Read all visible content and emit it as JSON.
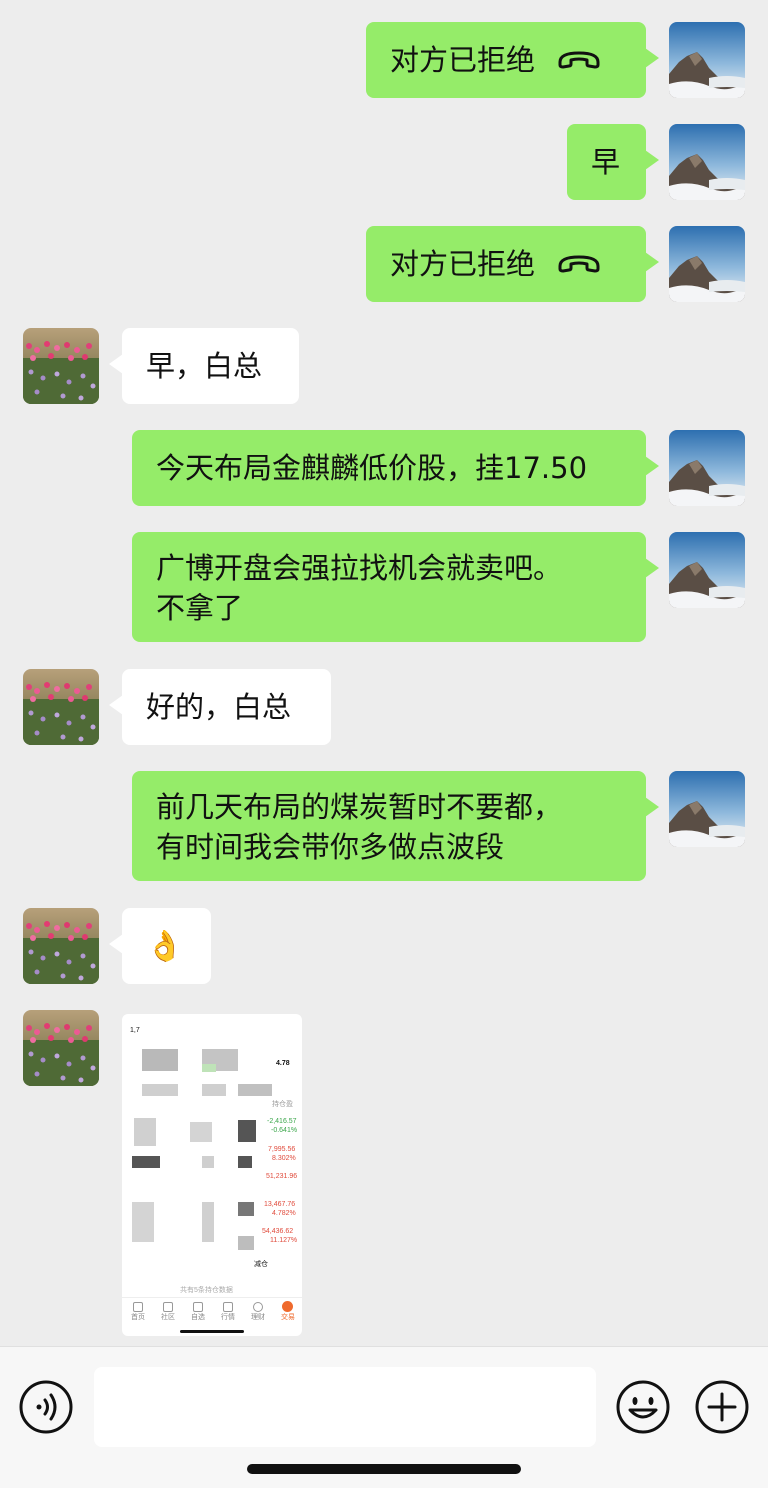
{
  "messages": [
    {
      "id": "m1",
      "side": "me",
      "text": "对方已拒绝",
      "type": "call"
    },
    {
      "id": "m2",
      "side": "me",
      "text": "早"
    },
    {
      "id": "m3",
      "side": "me",
      "text": "对方已拒绝",
      "type": "call"
    },
    {
      "id": "m4",
      "side": "other",
      "text": "早，白总"
    },
    {
      "id": "m5",
      "side": "me",
      "text": "今天布局金麒麟低价股，挂17.50"
    },
    {
      "id": "m6",
      "side": "me",
      "line1": "广博开盘会强拉找机会就卖吧。",
      "line2": "不拿了"
    },
    {
      "id": "m7",
      "side": "other",
      "text": "好的，白总"
    },
    {
      "id": "m8",
      "side": "me",
      "line1": "前几天布局的煤炭暂时不要都，",
      "line2": "有时间我会带你多做点波段"
    },
    {
      "id": "m9",
      "side": "other",
      "text": "👌",
      "icon": "ok-hand-emoji"
    },
    {
      "id": "m10",
      "side": "other",
      "type": "image"
    }
  ],
  "screenshot": {
    "top_label": "1,7",
    "value_a": "4.78",
    "label_b": "持仓盈",
    "rows": [
      {
        "v1": "-2,416.57",
        "v2": "-0.641%",
        "color": "#3aa64a"
      },
      {
        "v1": "7,995.56",
        "v2": "8.302%",
        "color": "#e04b3c"
      },
      {
        "v1": "51,231.96",
        "v2": "",
        "color": "#e04b3c"
      },
      {
        "v1": "13,467.76",
        "v2": "4.782%",
        "color": "#e04b3c"
      },
      {
        "v1": "54,436.62",
        "v2": "11.127%",
        "color": "#e04b3c"
      }
    ],
    "reduce_label": "减仓",
    "footer_label": "共有5条持仓数据",
    "tabs": [
      "首页",
      "社区",
      "自选",
      "行情",
      "理财",
      "交易"
    ]
  },
  "input_bar": {
    "voice_icon": "voice-icon",
    "emoji_icon": "emoji-icon",
    "plus_icon": "plus-icon",
    "input_value": ""
  },
  "colors": {
    "me_bubble": "#95ec69",
    "other_bubble": "#ffffff",
    "background": "#ededed"
  }
}
